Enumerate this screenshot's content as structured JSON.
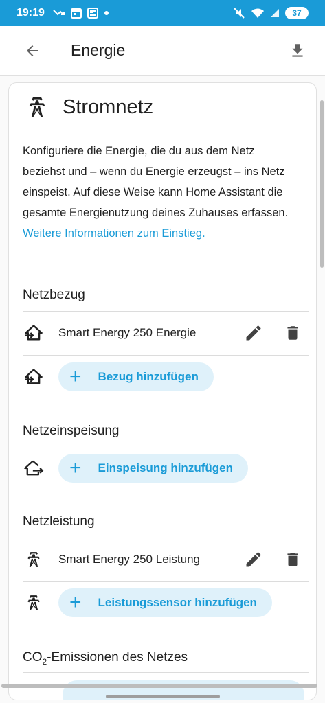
{
  "status_bar": {
    "time": "19:19",
    "battery": "37",
    "left_icons": [
      "missed-call-icon",
      "calendar-icon",
      "news-icon",
      "dot-icon"
    ],
    "right_icons": [
      "mute-icon",
      "wifi-icon",
      "signal-icon",
      "battery-icon"
    ]
  },
  "app_bar": {
    "title": "Energie"
  },
  "card": {
    "title": "Stromnetz",
    "description": "Konfiguriere die Energie, die du aus dem Netz beziehst und – wenn du Energie erzeugst – ins Netz einspeist. Auf diese Weise kann Home Assistant die gesamte Energienutzung deines Zuhauses erfassen. ",
    "link_text": "Weitere Informationen zum Einstieg."
  },
  "sections": {
    "bezug": {
      "title": "Netzbezug",
      "item_label": "Smart Energy 250 Energie",
      "add_label": "Bezug hinzufügen"
    },
    "einspeisung": {
      "title": "Netzeinspeisung",
      "add_label": "Einspeisung hinzufügen"
    },
    "leistung": {
      "title": "Netzleistung",
      "item_label": "Smart Energy 250 Leistung",
      "add_label": "Leistungssensor hinzufügen"
    },
    "co2": {
      "title_prefix": "CO",
      "title_sub": "2",
      "title_suffix": "-Emissionen des Netzes"
    }
  },
  "colors": {
    "accent": "#1a9bd7",
    "button_bg": "#dff1fa",
    "text": "#212121"
  }
}
